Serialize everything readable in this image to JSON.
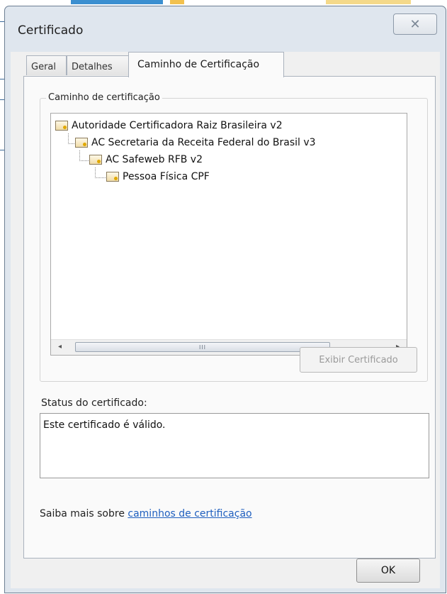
{
  "window": {
    "title": "Certificado",
    "close_glyph": "✕"
  },
  "tabs": [
    {
      "label": "Geral"
    },
    {
      "label": "Detalhes"
    },
    {
      "label": "Caminho de Certificação",
      "active": true
    }
  ],
  "path_group": {
    "label": "Caminho de certificação",
    "tree": [
      {
        "label": "Autoridade Certificadora Raiz Brasileira v2",
        "level": 0,
        "icon": "certificate-icon"
      },
      {
        "label": "AC Secretaria da Receita Federal do Brasil v3",
        "level": 1,
        "icon": "certificate-icon"
      },
      {
        "label": "AC Safeweb RFB v2",
        "level": 2,
        "icon": "certificate-icon"
      },
      {
        "label": "Pessoa Física CPF",
        "level": 3,
        "icon": "certificate-icon"
      }
    ],
    "scrollbar_thumb_grip": "III",
    "view_button": "Exibir Certificado"
  },
  "status": {
    "label": "Status do certificado:",
    "text": "Este certificado é válido."
  },
  "learn_more": {
    "prefix": "Saiba mais sobre",
    "link_text": "caminhos de certificação"
  },
  "ok_button": "OK",
  "colors": {
    "link": "#1f5fbf",
    "window_frame": "#dfe6ee"
  }
}
